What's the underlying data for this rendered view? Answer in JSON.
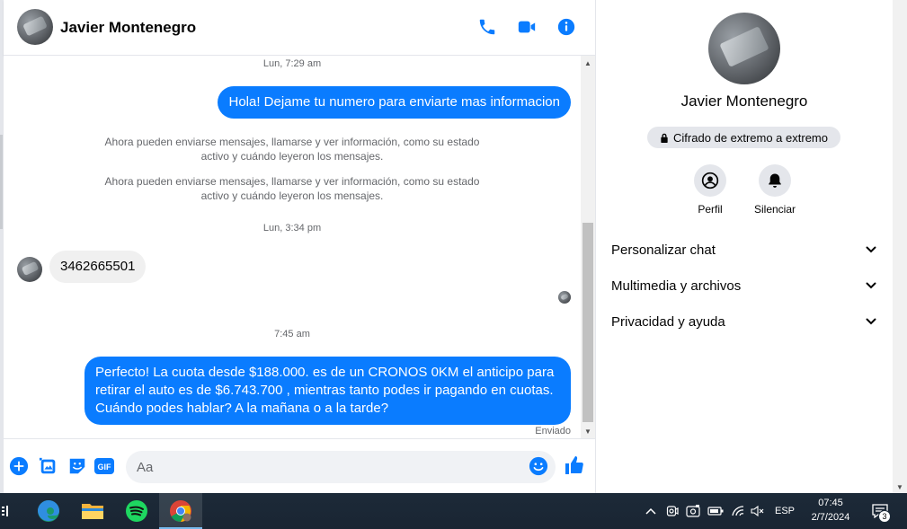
{
  "chat": {
    "contact_name": "Javier Montenegro",
    "messages": [
      {
        "type": "timestamp",
        "text": "Lun, 7:29 am"
      },
      {
        "type": "outgoing",
        "text": "Hola! Dejame tu numero para enviarte mas informacion"
      },
      {
        "type": "system",
        "text": "Ahora pueden enviarse mensajes, llamarse y ver información, como su estado activo y cuándo leyeron los mensajes."
      },
      {
        "type": "system",
        "text": "Ahora pueden enviarse mensajes, llamarse y ver información, como su estado activo y cuándo leyeron los mensajes."
      },
      {
        "type": "timestamp",
        "text": "Lun, 3:34 pm"
      },
      {
        "type": "incoming",
        "text": "3462665501"
      },
      {
        "type": "timestamp",
        "text": "7:45 am"
      },
      {
        "type": "outgoing",
        "text": "Perfecto! La cuota desde $188.000. es de un CRONOS 0KM el anticipo para retirar el auto es de $6.743.700 , mientras tanto podes ir pagando en cuotas. Cuándo podes hablar? A la mañana o a la tarde?"
      }
    ],
    "status_text": "Enviado",
    "composer_placeholder": "Aa"
  },
  "info_panel": {
    "name": "Javier Montenegro",
    "encryption_badge": "Cifrado de extremo a extremo",
    "actions": [
      {
        "label": "Perfil",
        "icon": "profile-icon"
      },
      {
        "label": "Silenciar",
        "icon": "bell-icon"
      }
    ],
    "sections": [
      {
        "label": "Personalizar chat"
      },
      {
        "label": "Multimedia y archivos"
      },
      {
        "label": "Privacidad y ayuda"
      }
    ]
  },
  "taskbar": {
    "apps": [
      "edge-icon",
      "file-explorer-icon",
      "spotify-icon",
      "chrome-icon"
    ],
    "language": "ESP",
    "time": "07:45",
    "date": "2/7/2024",
    "notification_count": "3"
  },
  "colors": {
    "accent": "#0a7cff",
    "messenger_blue": "#0084ff",
    "incoming_bubble": "#f0f0f0",
    "taskbar": "#1c2a38"
  }
}
